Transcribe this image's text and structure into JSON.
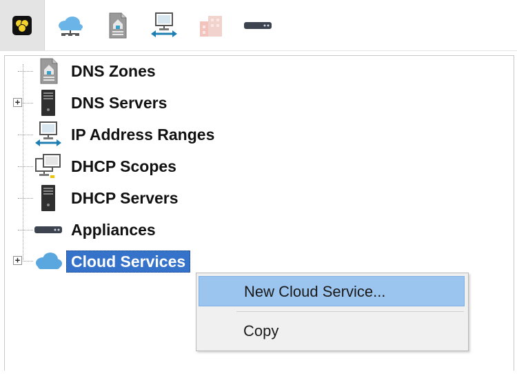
{
  "toolbar": {
    "buttons": [
      {
        "name": "Overview",
        "icon": "yellow-cluster-icon",
        "active": true
      },
      {
        "name": "Cloud Services",
        "icon": "cloud-network-icon"
      },
      {
        "name": "DNS Zones",
        "icon": "dns-zone-icon"
      },
      {
        "name": "IP Address Ranges",
        "icon": "ip-range-icon"
      },
      {
        "name": "DHCP Scopes",
        "icon": "building-icon",
        "disabled": true
      },
      {
        "name": "Appliances",
        "icon": "appliance-icon"
      }
    ]
  },
  "tree": {
    "items": [
      {
        "label": "DNS Zones",
        "icon": "dns-zone-icon",
        "expandable": false
      },
      {
        "label": "DNS Servers",
        "icon": "server-tower-icon",
        "expandable": true
      },
      {
        "label": "IP Address Ranges",
        "icon": "ip-range-icon",
        "expandable": false
      },
      {
        "label": "DHCP Scopes",
        "icon": "dhcp-monitors-icon",
        "expandable": false
      },
      {
        "label": "DHCP Servers",
        "icon": "server-tower-icon",
        "expandable": false
      },
      {
        "label": "Appliances",
        "icon": "appliance-icon",
        "expandable": false
      },
      {
        "label": "Cloud Services",
        "icon": "cloud-icon",
        "expandable": true,
        "selected": true
      }
    ],
    "expander_symbol": "+"
  },
  "context_menu": {
    "items": [
      {
        "label": "New Cloud Service...",
        "highlighted": true
      },
      {
        "label": "Copy"
      }
    ]
  },
  "colors": {
    "selection": "#3572c9",
    "menu_highlight": "#9bc4ee",
    "menu_background": "#f0f0f0",
    "cloud_blue": "#5aa7e0"
  }
}
